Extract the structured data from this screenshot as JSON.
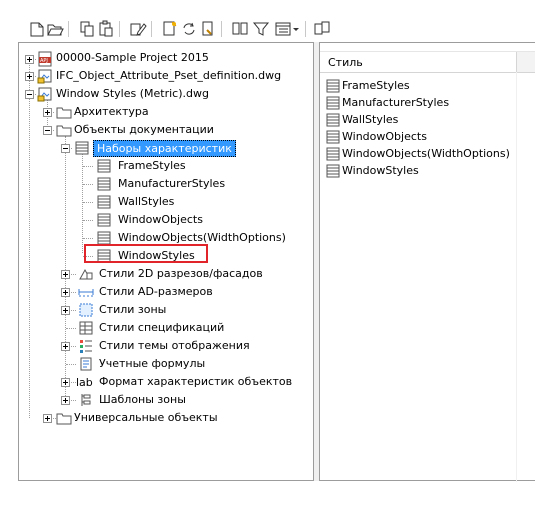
{
  "toolbar": {
    "buttons": [
      {
        "name": "new-icon"
      },
      {
        "name": "open-icon"
      },
      {
        "name": "copy-icon"
      },
      {
        "name": "paste-icon"
      },
      {
        "name": "edit-icon"
      },
      {
        "name": "new-style-icon"
      },
      {
        "name": "purge-icon"
      },
      {
        "name": "properties-icon"
      },
      {
        "name": "compare-icon"
      },
      {
        "name": "filter-icon"
      },
      {
        "name": "view-icon"
      },
      {
        "name": "toggle-view-icon"
      }
    ]
  },
  "tree": {
    "items": [
      {
        "label": "00000-Sample Project 2015",
        "icon": "project-icon"
      },
      {
        "label": "IFC_Object_Attribute_Pset_definition.dwg",
        "icon": "drawing-icon"
      },
      {
        "label": "Window Styles (Metric).dwg",
        "icon": "drawing-icon"
      },
      {
        "label": "Архитектура",
        "icon": "folder-icon"
      },
      {
        "label": "Объекты документации",
        "icon": "folder-icon"
      },
      {
        "label": "Наборы характеристик",
        "icon": "property-set-icon"
      },
      {
        "label": "FrameStyles",
        "icon": "property-set-icon"
      },
      {
        "label": "ManufacturerStyles",
        "icon": "property-set-icon"
      },
      {
        "label": "WallStyles",
        "icon": "property-set-icon"
      },
      {
        "label": "WindowObjects",
        "icon": "property-set-icon"
      },
      {
        "label": "WindowObjects(WidthOptions)",
        "icon": "property-set-icon"
      },
      {
        "label": "WindowStyles",
        "icon": "property-set-icon"
      },
      {
        "label": "Стили 2D разрезов/фасадов",
        "icon": "section-style-icon"
      },
      {
        "label": "Стили AD-размеров",
        "icon": "dimension-style-icon"
      },
      {
        "label": "Стили зоны",
        "icon": "zone-style-icon"
      },
      {
        "label": "Стили спецификаций",
        "icon": "schedule-style-icon"
      },
      {
        "label": "Стили темы отображения",
        "icon": "display-theme-icon"
      },
      {
        "label": "Учетные формулы",
        "icon": "formula-icon"
      },
      {
        "label": "Формат характеристик объектов",
        "icon": "property-format-icon"
      },
      {
        "label": "Шаблоны зоны",
        "icon": "zone-template-icon"
      },
      {
        "label": "Универсальные объекты",
        "icon": "folder-icon"
      }
    ]
  },
  "list": {
    "header": "Стиль",
    "items": [
      "FrameStyles",
      "ManufacturerStyles",
      "WallStyles",
      "WindowObjects",
      "WindowObjects(WidthOptions)",
      "WindowStyles"
    ]
  },
  "colors": {
    "selection": "#3399ff",
    "highlight_box": "#e0242a",
    "border": "#9c9c9c"
  }
}
